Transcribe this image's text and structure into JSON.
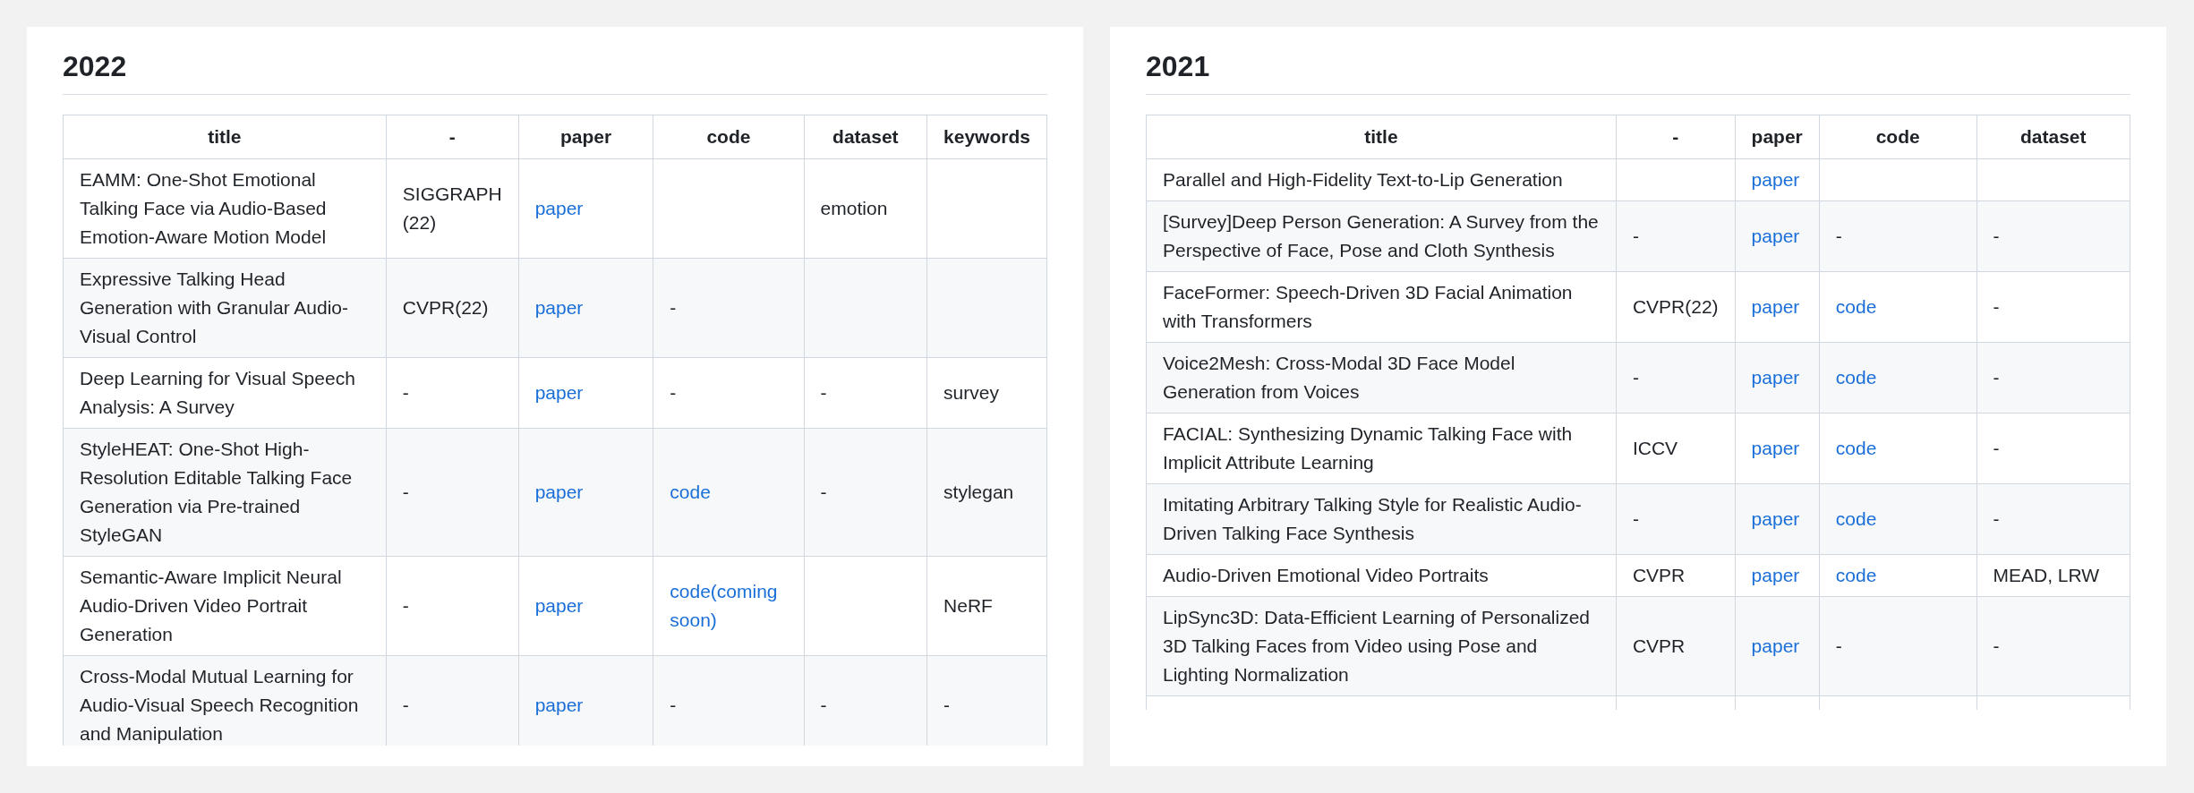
{
  "sections": [
    {
      "heading": "2022",
      "columns": [
        "title",
        "-",
        "paper",
        "code",
        "dataset",
        "keywords"
      ],
      "rows": [
        [
          {
            "kind": "text",
            "text": "EAMM: One-Shot Emotional Talking Face via Audio-Based Emotion-Aware Motion Model"
          },
          {
            "kind": "text",
            "text": "SIGGRAPH (22)"
          },
          {
            "kind": "link",
            "text": "paper"
          },
          null,
          {
            "kind": "text",
            "text": "emotion"
          },
          null
        ],
        [
          {
            "kind": "text",
            "text": "Expressive Talking Head Generation with Granular Audio-Visual Control"
          },
          {
            "kind": "text",
            "text": "CVPR(22)"
          },
          {
            "kind": "link",
            "text": "paper"
          },
          {
            "kind": "text",
            "text": "-"
          },
          null,
          null
        ],
        [
          {
            "kind": "text",
            "text": "Deep Learning for Visual Speech Analysis: A Survey"
          },
          {
            "kind": "text",
            "text": "-"
          },
          {
            "kind": "link",
            "text": "paper"
          },
          {
            "kind": "text",
            "text": "-"
          },
          {
            "kind": "text",
            "text": "-"
          },
          {
            "kind": "text",
            "text": "survey"
          }
        ],
        [
          {
            "kind": "text",
            "text": "StyleHEAT: One-Shot High-Resolution Editable Talking Face Generation via Pre-trained StyleGAN"
          },
          {
            "kind": "text",
            "text": "-"
          },
          {
            "kind": "link",
            "text": "paper"
          },
          {
            "kind": "link",
            "text": "code"
          },
          {
            "kind": "text",
            "text": "-"
          },
          {
            "kind": "text",
            "text": "stylegan"
          }
        ],
        [
          {
            "kind": "text",
            "text": "Semantic-Aware Implicit Neural Audio-Driven Video Portrait Generation"
          },
          {
            "kind": "text",
            "text": "-"
          },
          {
            "kind": "link",
            "text": "paper"
          },
          {
            "kind": "link",
            "text": "code(coming soon)"
          },
          null,
          {
            "kind": "text",
            "text": "NeRF"
          }
        ],
        [
          {
            "kind": "text",
            "text": "Cross-Modal Mutual Learning for Audio-Visual Speech Recognition and Manipulation"
          },
          {
            "kind": "text",
            "text": "-"
          },
          {
            "kind": "link",
            "text": "paper"
          },
          {
            "kind": "text",
            "text": "-"
          },
          {
            "kind": "text",
            "text": "-"
          },
          {
            "kind": "text",
            "text": "-"
          }
        ]
      ]
    },
    {
      "heading": "2021",
      "columns": [
        "title",
        "-",
        "paper",
        "code",
        "dataset"
      ],
      "rows": [
        [
          {
            "kind": "text",
            "text": "Parallel and High-Fidelity Text-to-Lip Generation"
          },
          null,
          {
            "kind": "link",
            "text": "paper"
          },
          null,
          null
        ],
        [
          {
            "kind": "text",
            "text": "[Survey]Deep Person Generation: A Survey from the Perspective of Face, Pose and Cloth Synthesis"
          },
          {
            "kind": "text",
            "text": "-"
          },
          {
            "kind": "link",
            "text": "paper"
          },
          {
            "kind": "text",
            "text": "-"
          },
          {
            "kind": "text",
            "text": "-"
          }
        ],
        [
          {
            "kind": "text",
            "text": "FaceFormer: Speech-Driven 3D Facial Animation with Transformers"
          },
          {
            "kind": "text",
            "text": "CVPR(22)"
          },
          {
            "kind": "link",
            "text": "paper"
          },
          {
            "kind": "link",
            "text": "code"
          },
          {
            "kind": "text",
            "text": "-"
          }
        ],
        [
          {
            "kind": "text",
            "text": "Voice2Mesh: Cross-Modal 3D Face Model Generation from Voices"
          },
          {
            "kind": "text",
            "text": "-"
          },
          {
            "kind": "link",
            "text": "paper"
          },
          {
            "kind": "link",
            "text": "code"
          },
          {
            "kind": "text",
            "text": "-"
          }
        ],
        [
          {
            "kind": "text",
            "text": "FACIAL: Synthesizing Dynamic Talking Face with Implicit Attribute Learning"
          },
          {
            "kind": "text",
            "text": "ICCV"
          },
          {
            "kind": "link",
            "text": "paper"
          },
          {
            "kind": "link",
            "text": "code"
          },
          {
            "kind": "text",
            "text": "-"
          }
        ],
        [
          {
            "kind": "text",
            "text": "Imitating Arbitrary Talking Style for Realistic Audio-Driven Talking Face Synthesis"
          },
          {
            "kind": "text",
            "text": "-"
          },
          {
            "kind": "link",
            "text": "paper"
          },
          {
            "kind": "link",
            "text": "code"
          },
          {
            "kind": "text",
            "text": "-"
          }
        ],
        [
          {
            "kind": "text",
            "text": "Audio-Driven Emotional Video Portraits"
          },
          {
            "kind": "text",
            "text": "CVPR"
          },
          {
            "kind": "link",
            "text": "paper"
          },
          {
            "kind": "link",
            "text": "code"
          },
          {
            "kind": "text",
            "text": "MEAD, LRW"
          }
        ],
        [
          {
            "kind": "text",
            "text": "LipSync3D: Data-Efficient Learning of Personalized 3D Talking Faces from Video using Pose and Lighting Normalization"
          },
          {
            "kind": "text",
            "text": "CVPR"
          },
          {
            "kind": "link",
            "text": "paper"
          },
          {
            "kind": "text",
            "text": "-"
          },
          {
            "kind": "text",
            "text": "-"
          }
        ]
      ]
    }
  ]
}
